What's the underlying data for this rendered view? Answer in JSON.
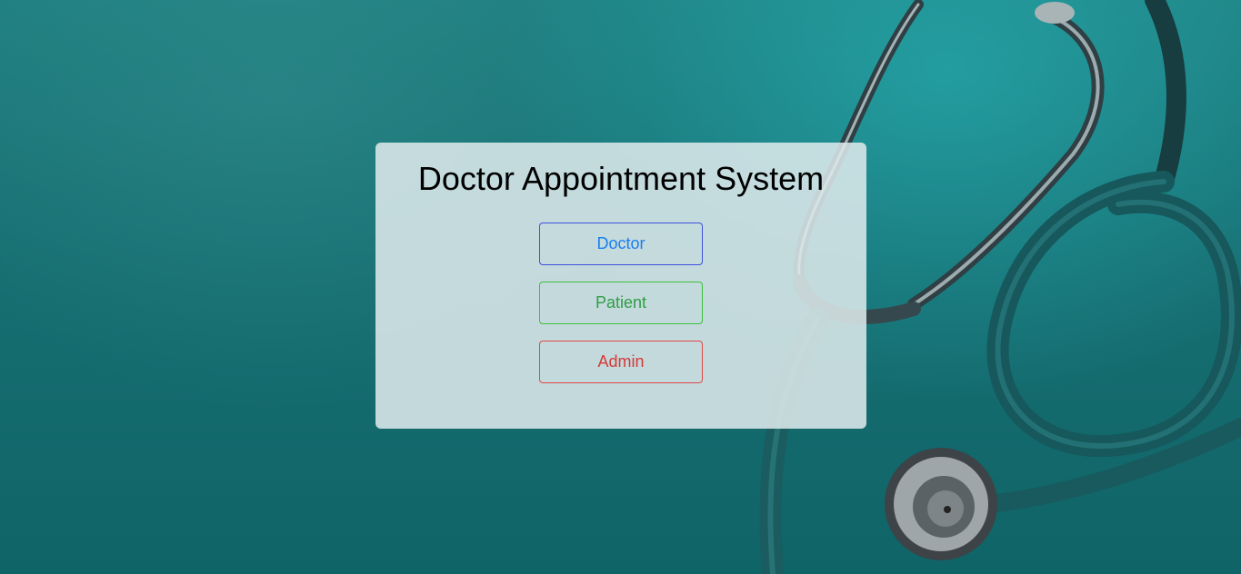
{
  "page": {
    "title": "Doctor Appointment System"
  },
  "buttons": {
    "doctor": "Doctor",
    "patient": "Patient",
    "admin": "Admin"
  },
  "colors": {
    "background": "#176f72",
    "card": "#dce8eb",
    "doctor": "#1a7ff0",
    "patient": "#2f9e44",
    "admin": "#d63a3a"
  },
  "background_image": "stethoscope-image"
}
